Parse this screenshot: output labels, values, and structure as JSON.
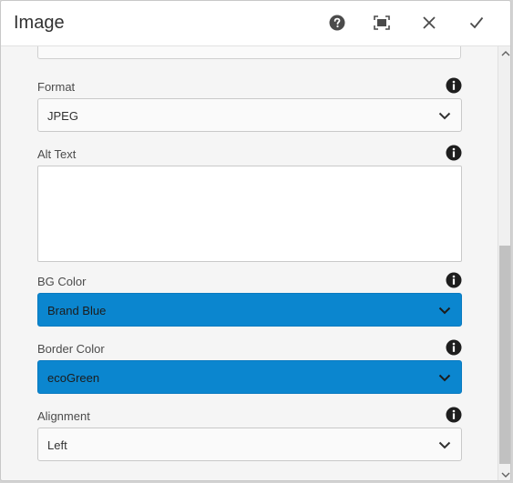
{
  "dialog": {
    "title": "Image",
    "header_buttons": [
      "help-icon",
      "fullscreen-icon",
      "close-icon",
      "check-icon"
    ]
  },
  "fields": {
    "format": {
      "label": "Format",
      "value": "JPEG"
    },
    "alt_text": {
      "label": "Alt Text",
      "value": ""
    },
    "bg_color": {
      "label": "BG Color",
      "value": "Brand Blue"
    },
    "border_color": {
      "label": "Border Color",
      "value": "ecoGreen"
    },
    "alignment": {
      "label": "Alignment",
      "value": "Left"
    }
  },
  "colors": {
    "selected_field_bg": "#0b86cf",
    "header_bg": "#ffffff",
    "panel_bg": "#f5f5f5"
  }
}
